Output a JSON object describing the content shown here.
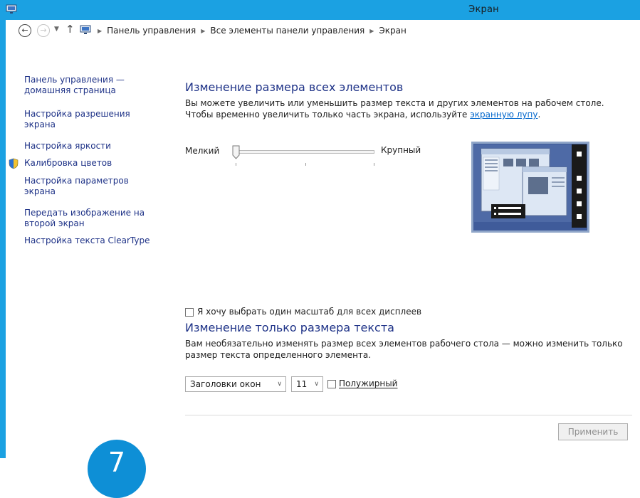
{
  "window": {
    "title": "Экран"
  },
  "breadcrumb": {
    "items": [
      "Панель управления",
      "Все элементы панели управления",
      "Экран"
    ]
  },
  "sidebar": {
    "items": [
      {
        "label": "Панель управления — домашняя страница"
      },
      {
        "label": "Настройка разрешения экрана"
      },
      {
        "label": "Настройка яркости"
      },
      {
        "label": "Калибровка цветов",
        "icon": "shield-icon"
      },
      {
        "label": "Настройка параметров экрана"
      },
      {
        "label": "Передать изображение на второй экран"
      },
      {
        "label": "Настройка текста ClearType"
      }
    ]
  },
  "section1": {
    "title": "Изменение размера всех элементов",
    "desc_part1": "Вы можете увеличить или уменьшить размер текста и других элементов на рабочем столе. Чтобы временно увеличить только часть экрана, используйте ",
    "link": "экранную лупу",
    "desc_part2": "."
  },
  "slider": {
    "min_label": "Мелкий",
    "max_label": "Крупный",
    "value_fraction": 0.0
  },
  "checkbox_scale": {
    "label": "Я хочу выбрать один масштаб для всех дисплеев",
    "checked": false
  },
  "section2": {
    "title": "Изменение только размера текста",
    "desc": "Вам необязательно изменять размер всех элементов рабочего стола — можно изменить только размер текста определенного элемента."
  },
  "text_controls": {
    "element_value": "Заголовки окон",
    "size_value": "11",
    "bold_label": "Полужирный",
    "bold_checked": false
  },
  "apply_label": "Применить",
  "badge_text": "7",
  "colors": {
    "accent": "#1ba1e2",
    "link": "#1e3287",
    "heading": "#1e3287",
    "badge": "#0e8fd6"
  }
}
